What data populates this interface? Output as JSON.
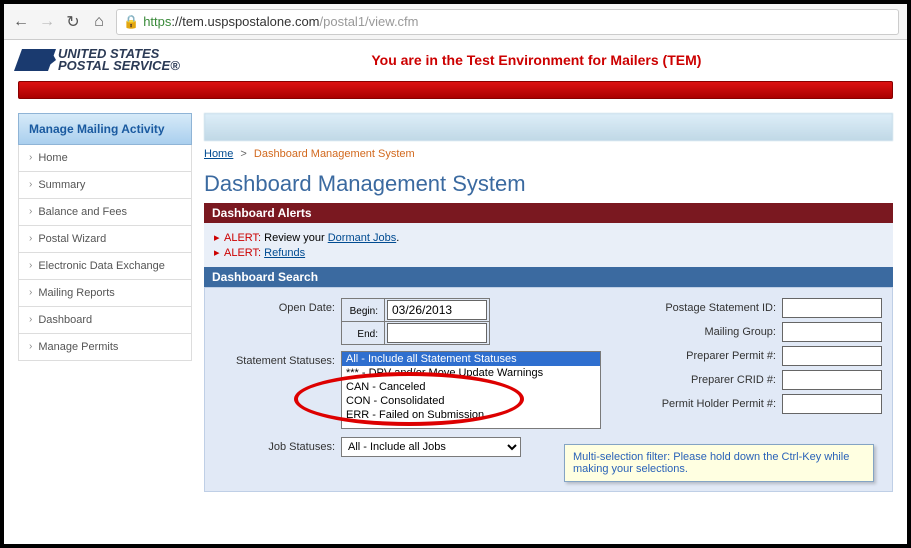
{
  "url": {
    "proto": "https",
    "host": "://tem.uspspostalone.com",
    "path": "/postal1/view.cfm"
  },
  "header": {
    "brand_line1": "UNITED STATES",
    "brand_line2": "POSTAL SERVICE®",
    "tem_banner": "You are in the Test Environment for Mailers (TEM)"
  },
  "sidebar": {
    "title": "Manage Mailing Activity",
    "items": [
      {
        "label": "Home"
      },
      {
        "label": "Summary"
      },
      {
        "label": "Balance and Fees"
      },
      {
        "label": "Postal Wizard"
      },
      {
        "label": "Electronic Data Exchange"
      },
      {
        "label": "Mailing Reports"
      },
      {
        "label": "Dashboard"
      },
      {
        "label": "Manage Permits"
      }
    ]
  },
  "breadcrumb": {
    "home": "Home",
    "current": "Dashboard Management System"
  },
  "page_title": "Dashboard Management System",
  "alerts": {
    "bar_title": "Dashboard Alerts",
    "rows": [
      {
        "prefix": "ALERT:",
        "text": " Review your ",
        "link": "Dormant Jobs",
        "suffix": "."
      },
      {
        "prefix": "ALERT:",
        "text": " ",
        "link": "Refunds",
        "suffix": ""
      }
    ]
  },
  "search": {
    "bar_title": "Dashboard Search",
    "open_date_label": "Open Date:",
    "begin_label": "Begin:",
    "end_label": "End:",
    "begin_value": "03/26/2013",
    "end_value": "",
    "statement_statuses_label": "Statement Statuses:",
    "statement_options": [
      "All - Include all Statement Statuses",
      "*** - DPV and/or Move Update Warnings",
      "CAN - Canceled",
      "CON - Consolidated",
      "ERR - Failed on Submission"
    ],
    "statement_selected_index": 0,
    "job_statuses_label": "Job Statuses:",
    "job_selected": "All - Include all Jobs",
    "right_fields": [
      {
        "label": "Postage Statement ID:"
      },
      {
        "label": "Mailing Group:"
      },
      {
        "label": "Preparer Permit #:"
      },
      {
        "label": "Preparer CRID #:"
      },
      {
        "label": "Permit Holder Permit #:"
      }
    ]
  },
  "tooltip": "Multi-selection filter: Please hold down the Ctrl-Key while making your selections."
}
